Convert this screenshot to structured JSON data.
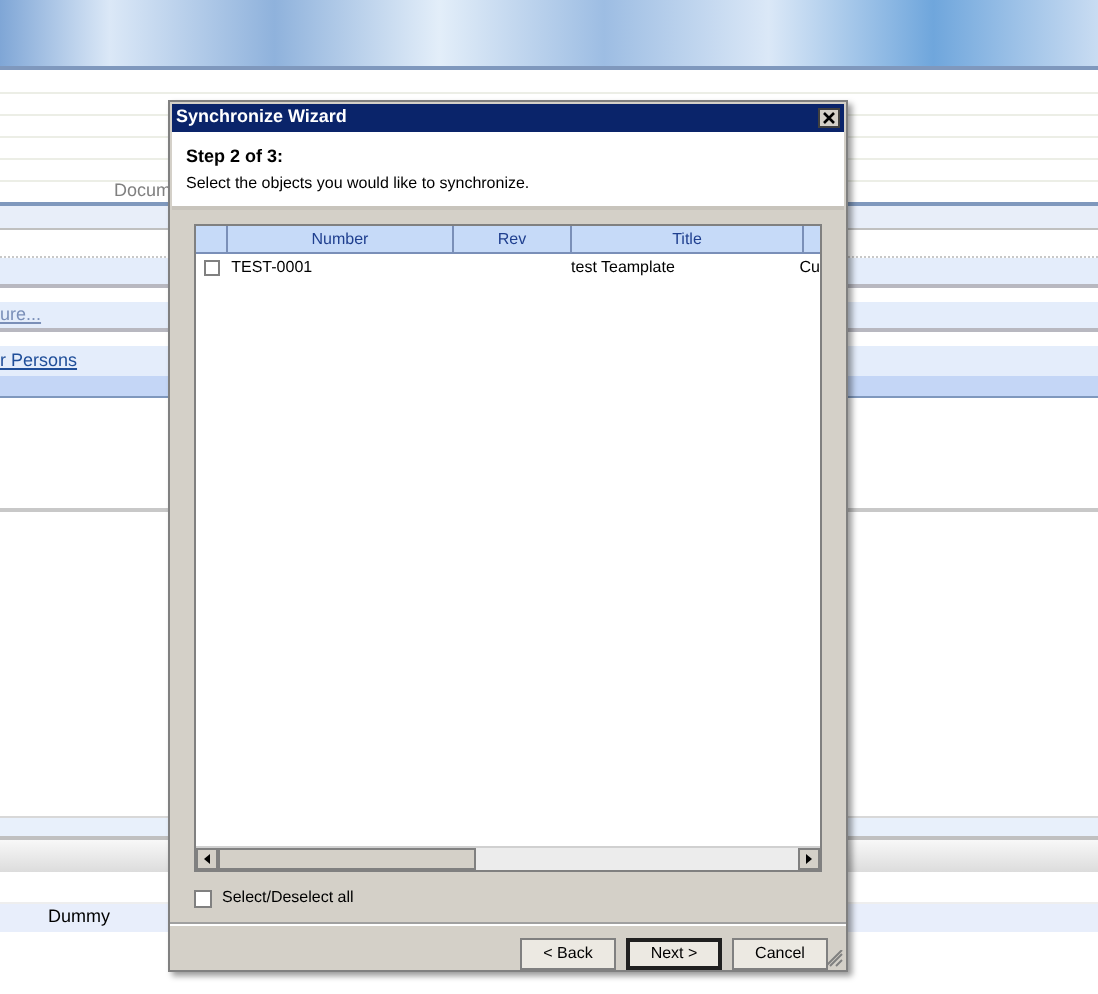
{
  "background": {
    "document_label": "Docum",
    "link_1": "ure...",
    "link_2": "r Persons",
    "row_value": "Dummy"
  },
  "dialog": {
    "title": "Synchronize Wizard",
    "step": "Step 2 of 3:",
    "instruction": "Select the objects you would like to synchronize.",
    "table": {
      "columns": [
        "Number",
        "Rev",
        "Title"
      ],
      "rows": [
        {
          "checked": false,
          "number": "TEST-0001",
          "title": "test Teamplate",
          "column_4": "Cu"
        }
      ]
    },
    "select_all": {
      "label": "Select/Deselect all",
      "checked": false
    },
    "buttons": [
      {
        "label": "< Back",
        "default": false
      },
      {
        "label": "Next >",
        "default": true
      },
      {
        "label": "Cancel",
        "default": false
      }
    ]
  }
}
